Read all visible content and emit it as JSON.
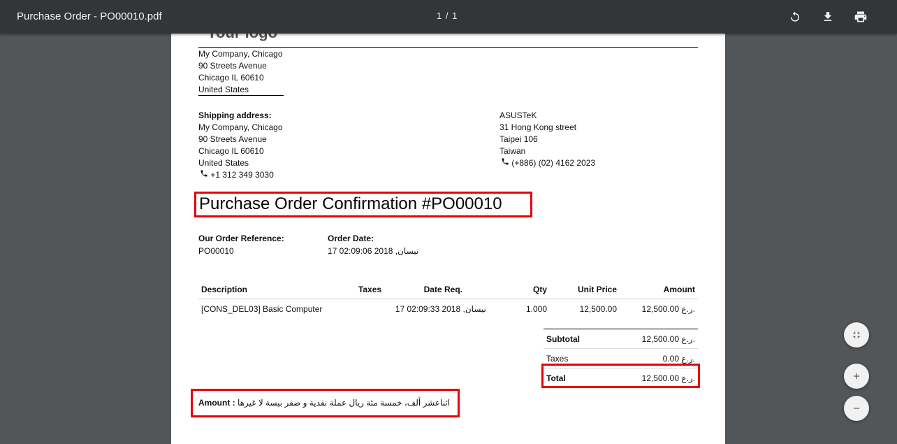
{
  "viewer": {
    "title": "Purchase Order - PO00010.pdf",
    "page_indicator": "1  /  1",
    "icons": [
      "rotate-icon",
      "download-icon",
      "print-icon",
      "fit-page-icon",
      "zoom-in-icon",
      "zoom-out-icon"
    ]
  },
  "doc": {
    "company": {
      "logo_partial": "Your logo",
      "lines": [
        "My Company, Chicago",
        "90 Streets Avenue",
        "Chicago IL 60610",
        "United States"
      ]
    },
    "shipping": {
      "heading": "Shipping address:",
      "lines": [
        "My Company, Chicago",
        "90 Streets Avenue",
        "Chicago IL 60610",
        "United States"
      ],
      "phone": "+1 312 349 3030"
    },
    "vendor": {
      "lines": [
        "ASUSTeK",
        "31 Hong Kong street",
        "Taipei 106",
        "Taiwan"
      ],
      "phone": "(+886) (02) 4162 2023"
    },
    "title": "Purchase Order Confirmation #PO00010",
    "order_ref": {
      "label": "Our Order Reference:",
      "value": "PO00010"
    },
    "order_date": {
      "label": "Order Date:",
      "value": "17 02:09:06 2018 ,نيسان"
    },
    "table": {
      "headers": {
        "description": "Description",
        "taxes": "Taxes",
        "date_req": "Date Req.",
        "qty": "Qty",
        "unit_price": "Unit Price",
        "amount": "Amount"
      },
      "rows": [
        {
          "description": "[CONS_DEL03] Basic Computer",
          "taxes": "",
          "date_req": "17 02:09:33 2018 ,نيسان",
          "qty": "1.000",
          "unit_price": "12,500.00",
          "amount": "12,500.00 ر.ع."
        }
      ]
    },
    "totals": {
      "subtotal_label": "Subtotal",
      "subtotal_value": "12,500.00 ر.ع.",
      "taxes_label": "Taxes",
      "taxes_value": "0.00 ر.ع.",
      "total_label": "Total",
      "total_value": "12,500.00 ر.ع."
    },
    "amount_words": {
      "label": "Amount :",
      "value": "اثناعشر ألف، خمسة مئة ريال عملة نقدية و صفر بيسة لا غيرها"
    }
  },
  "colors": {
    "toolbar": "#323639",
    "background": "#525659",
    "highlight": "#e8000b"
  }
}
